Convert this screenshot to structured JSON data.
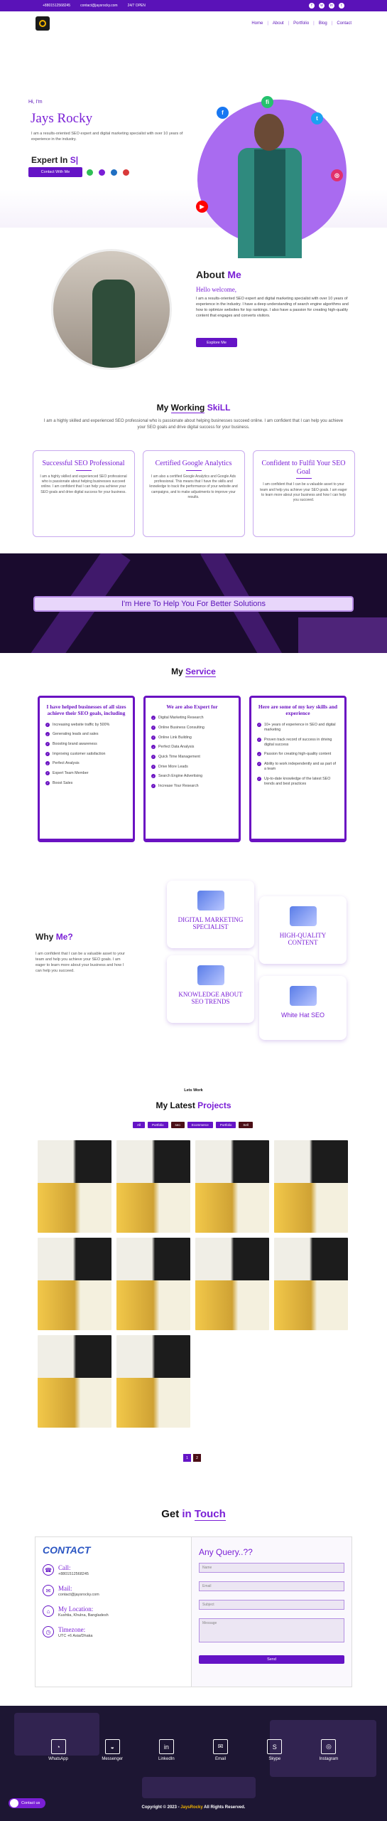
{
  "topbar": {
    "phone": "+8801512568245",
    "email": "contact@jaysrocky.com",
    "hours": "24/7 OPEN"
  },
  "nav": {
    "items": [
      "Home",
      "About",
      "Portfolio",
      "Blog",
      "Contact"
    ]
  },
  "hero": {
    "greeting": "Hi, I'm",
    "name": "Jays Rocky",
    "intro": "I am a results-oriented SEO expert and digital marketing specialist with over 10 years of experience in the industry.",
    "expert_prefix": "Expert In",
    "expert_typed": "S|",
    "contact_btn": "Contact With Me"
  },
  "about": {
    "title_a": "About",
    "title_b": "Me",
    "hello": "Hello welcome,",
    "text": "I am a results-oriented SEO expert and digital marketing specialist with over 10 years of experience in the industry. I have a deep understanding of search engine algorithms and how to optimize websites for top rankings. I also have a passion for creating high-quality content that engages and converts visitors.",
    "button": "Explore Me"
  },
  "skill": {
    "title_a": "My",
    "title_b": "Working",
    "title_c": "SkiLL",
    "subtitle": "I am a highly skilled and experienced SEO professional who is passionate about helping businesses succeed online. I am confident that I can help you achieve your SEO goals and drive digital success for your business.",
    "cards": [
      {
        "title": "Successful SEO Professional",
        "text": "I am a highly skilled and experienced SEO professional who is passionate about helping businesses succeed online. I am confident that I can help you achieve your SEO goals and drive digital success for your business."
      },
      {
        "title": "Certified Google Analytics",
        "text": "I am also a certified Google Analytics and Google Ads professional. This means that I have the skills and knowledge to track the performance of your website and campaigns, and to make adjustments to improve your results."
      },
      {
        "title": "Confident to Fulfil Your SEO Goal",
        "text": "I am confident that I can be a valuable asset to your team and help you achieve your SEO goals. I am eager to learn more about your business and how I can help you succeed."
      }
    ]
  },
  "banner": {
    "text": "I'm Here To Help You For Better Solutions"
  },
  "service": {
    "title_a": "My",
    "title_b": "Service",
    "cards": [
      {
        "title": "I have helped businesses of all sizes achieve their SEO goals, including",
        "items": [
          "Increasing website traffic by 500%",
          "Generating leads and sales",
          "Boosting brand awareness",
          "Improving customer satisfaction",
          "Perfect Analysis",
          "Expert Team Member",
          "Boost Sales"
        ]
      },
      {
        "title": "We are also Expert for",
        "items": [
          "Digital Marketing Research",
          "Online Business Consulting",
          "Online Link Building",
          "Perfect Data Analysis",
          "Quick Time Management",
          "Drive More Leads",
          "Search Engine Advertising",
          "Increase Your Research"
        ]
      },
      {
        "title": "Here are some of my key skills and experience",
        "items": [
          "10+ years of experience in SEO and digital marketing",
          "Proven track record of success in driving digital success",
          "Passion for creating high-quality content",
          "Ability to work independently and as part of a team",
          "Up-to-date knowledge of the latest SEO trends and best practices"
        ]
      }
    ]
  },
  "why": {
    "title_a": "Why",
    "title_b": "Me?",
    "text": "I am confident that I can be a valuable asset to your team and help you achieve your SEO goals. I am eager to learn more about your business and how I can help you succeed.",
    "cards": [
      "DIGITAL MARKETING SPECIALIST",
      "HIGH-QUALITY CONTENT",
      "KNOWLEDGE ABOUT SEO TRENDS",
      "White Hat SEO"
    ]
  },
  "projects": {
    "pre": "Lets Work",
    "title_a": "My Latest",
    "title_b": "Projects",
    "filters": [
      "All",
      "Portfolio",
      "seo",
      "Ecommerce",
      "Portfolio",
      "Sell"
    ],
    "pages": [
      "1",
      "2"
    ]
  },
  "contact": {
    "title_a": "Get",
    "title_b": "in",
    "title_c": "Touch",
    "logo_text": "CONTACT",
    "items": [
      {
        "label": "Call:",
        "value": "+8801512568245"
      },
      {
        "label": "Mail:",
        "value": "contact@jaysrocky.com"
      },
      {
        "label": "My Location:",
        "value": "Kushtia, Khulna, Bangladesh"
      },
      {
        "label": "Timezone:",
        "value": "UTC +6 Asia/Dhaka"
      }
    ],
    "form_title": "Any Query..??",
    "placeholders": [
      "Name",
      "Email",
      "Subject",
      "Message"
    ],
    "send": "Send"
  },
  "footer": {
    "links": [
      "WhatsApp",
      "Messenger",
      "LinkedIn",
      "Email",
      "Skype",
      "Instagram"
    ],
    "copy_a": "Copyright © 2023 -",
    "copy_b": "JaysRocky",
    "copy_c": "All Rights Reserved.",
    "chat": "Contact us"
  },
  "colors": {
    "accent": "#7a1fd6",
    "dark_purple": "#5a12b8",
    "button": "#6514c6"
  }
}
